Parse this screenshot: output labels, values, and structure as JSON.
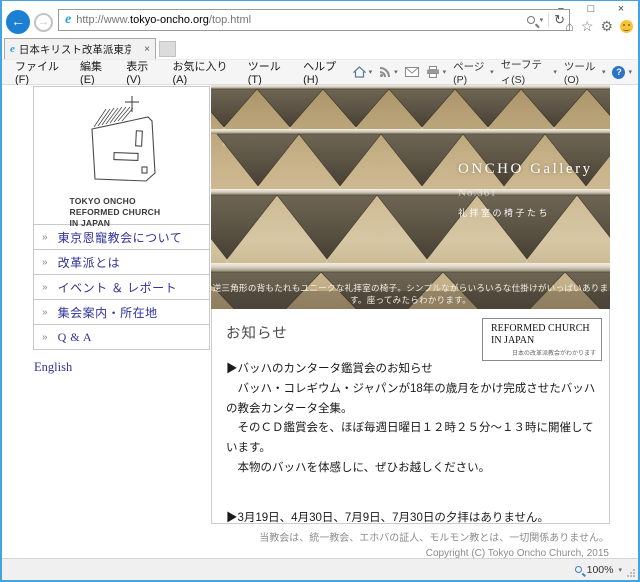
{
  "icons": {
    "back": "←",
    "forward": "→",
    "minimize": "−",
    "maximize": "□",
    "close": "×",
    "tab_close": "×",
    "refresh": "↻",
    "home": "⌂",
    "star": "☆",
    "gear": "⚙",
    "dropdown": "▾",
    "help": "?",
    "ie_logo": "e",
    "nav_bullet": "»"
  },
  "browser": {
    "tab_title": "日本キリスト改革派東京恩寵...",
    "url": {
      "prefix": "http://www.",
      "domain": "tokyo-oncho.org",
      "path": "/top.html"
    },
    "menu": [
      "ファイル(F)",
      "編集(E)",
      "表示(V)",
      "お気に入り(A)",
      "ツール(T)",
      "ヘルプ(H)"
    ],
    "command": [
      "ページ(P)",
      "セーフティ(S)",
      "ツール(O)"
    ],
    "status_zoom": "100%"
  },
  "sidebar": {
    "logo_caption": "TOKYO ONCHO\nREFORMED CHURCH\nIN JAPAN",
    "nav": [
      "東京恩寵教会について",
      "改革派とは",
      "イベント ＆ レポート",
      "集会案内・所在地",
      "Q & A"
    ],
    "english": "English"
  },
  "hero": {
    "title": "ONCHO Gallery",
    "number": "No.361",
    "subtitle": "礼拝室の椅子たち",
    "caption": "逆三角形の背もたれもユニークな礼拝室の椅子。シンプルながらいろいろな仕掛けがいっぱいあります。座ってみたらわかります。"
  },
  "news": {
    "heading": "お知らせ",
    "banner": {
      "title": "REFORMED CHURCH\nIN JAPAN",
      "tagline": "日本の改革派教会がわかります"
    },
    "items": [
      "▶バッハのカンタータ鑑賞会のお知らせ",
      "　バッハ・コレギウム・ジャパンが18年の歳月をかけ完成させたバッハの教会カンタータ全集。",
      "　そのＣＤ鑑賞会を、ほぼ毎週日曜日１２時２５分～１３時に開催しています。",
      "　本物のバッハを体感しに、ぜひお越しください。",
      "▶3月19日、4月30日、7月9日、7月30日の夕拝はありません。"
    ]
  },
  "footer": {
    "disclaimer": "当教会は、統一教会、エホバの証人、モルモン教とは、一切関係ありません。",
    "copyright": "Copyright (C) Tokyo Oncho Church, 2015"
  }
}
